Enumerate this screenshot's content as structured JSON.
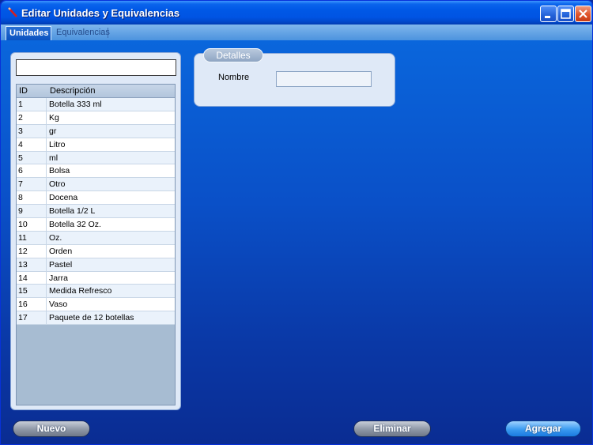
{
  "window": {
    "title": "Editar Unidades y Equivalencias",
    "icon": "pencil-icon",
    "controls": [
      "minimize-icon",
      "maximize-icon",
      "close-icon"
    ]
  },
  "tabs": [
    {
      "label": "Unidades",
      "active": true
    },
    {
      "label": "Equivalencias",
      "active": false
    }
  ],
  "search": {
    "value": "",
    "placeholder": ""
  },
  "table": {
    "columns": [
      "ID",
      "Descripción"
    ],
    "rows": [
      {
        "id": "1",
        "desc": "Botella 333 ml"
      },
      {
        "id": "2",
        "desc": "Kg"
      },
      {
        "id": "3",
        "desc": "gr"
      },
      {
        "id": "4",
        "desc": "Litro"
      },
      {
        "id": "5",
        "desc": "ml"
      },
      {
        "id": "6",
        "desc": "Bolsa"
      },
      {
        "id": "7",
        "desc": "Otro"
      },
      {
        "id": "8",
        "desc": "Docena"
      },
      {
        "id": "9",
        "desc": "Botella 1/2 L"
      },
      {
        "id": "10",
        "desc": "Botella 32 Oz."
      },
      {
        "id": "11",
        "desc": "Oz."
      },
      {
        "id": "12",
        "desc": "Orden"
      },
      {
        "id": "13",
        "desc": "Pastel"
      },
      {
        "id": "14",
        "desc": "Jarra"
      },
      {
        "id": "15",
        "desc": "Medida Refresco"
      },
      {
        "id": "16",
        "desc": "Vaso"
      },
      {
        "id": "17",
        "desc": "Paquete de 12 botellas"
      }
    ]
  },
  "details": {
    "legend": "Detalles",
    "nombre_label": "Nombre",
    "nombre_value": ""
  },
  "buttons": {
    "nuevo": "Nuevo",
    "eliminar": "Eliminar",
    "agregar": "Agregar"
  },
  "colors": {
    "titlebar": "#0054e3",
    "background": "#0a50c8",
    "panel": "#dfe9f7",
    "accent": "#3a9af0"
  }
}
